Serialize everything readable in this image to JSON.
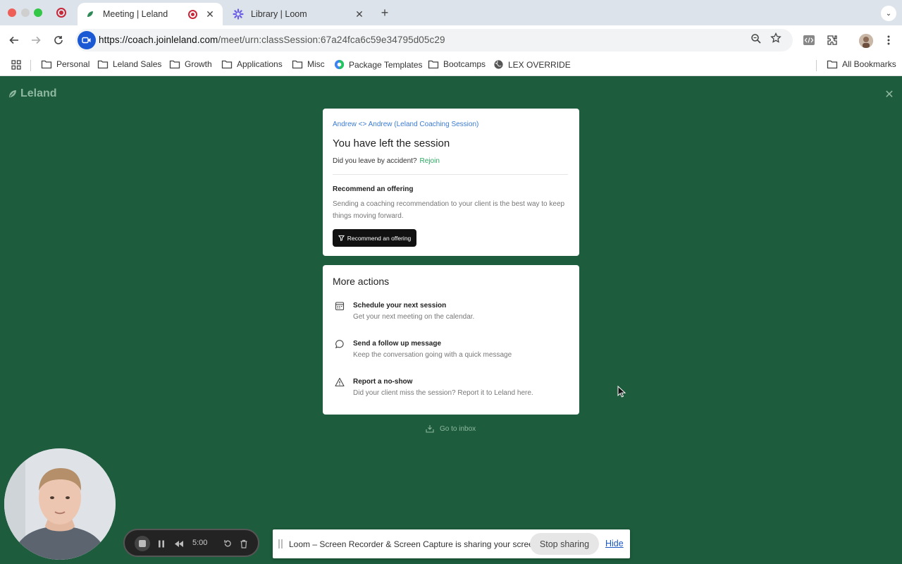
{
  "browser": {
    "tabs": [
      {
        "title": "Meeting | Leland",
        "active": true
      },
      {
        "title": "Library | Loom",
        "active": false
      }
    ],
    "url": {
      "host": "https://coach.joinleland.com",
      "path": "/meet/urn:classSession:67a24fca6c59e34795d05c29"
    },
    "bookmarks": [
      {
        "label": "Personal",
        "icon": "folder-icon"
      },
      {
        "label": "Leland Sales",
        "icon": "folder-icon"
      },
      {
        "label": "Growth",
        "icon": "folder-icon"
      },
      {
        "label": "Applications",
        "icon": "folder-icon"
      },
      {
        "label": "Misc",
        "icon": "folder-icon"
      },
      {
        "label": "Package Templates",
        "icon": "globe-color-icon"
      },
      {
        "label": "Bootcamps",
        "icon": "folder-icon"
      },
      {
        "label": "LEX OVERRIDE",
        "icon": "globe-icon"
      },
      {
        "label": "All Bookmarks",
        "icon": "folder-icon"
      }
    ]
  },
  "page": {
    "brand": "Leland",
    "session_card": {
      "session_name": "Andrew <> Andrew (Leland Coaching Session)",
      "title": "You have left the session",
      "accident_prompt": "Did you leave by accident?",
      "rejoin_label": "Rejoin",
      "recommend_title": "Recommend an offering",
      "recommend_desc": "Sending a coaching recommendation to your client is the best way to keep things moving forward.",
      "recommend_button": "Recommend an offering"
    },
    "more_actions": {
      "title": "More actions",
      "items": [
        {
          "title": "Schedule your next session",
          "desc": "Get your next meeting on the calendar.",
          "icon": "calendar-icon"
        },
        {
          "title": "Send a follow up message",
          "desc": "Keep the conversation going with a quick message",
          "icon": "chat-bubble-icon"
        },
        {
          "title": "Report a no-show",
          "desc": "Did your client miss the session? Report it to Leland here.",
          "icon": "warning-icon"
        }
      ]
    },
    "inbox_label": "Go to inbox"
  },
  "loom": {
    "timer": "5:00",
    "share_text": "Loom – Screen Recorder & Screen Capture is sharing your screen.",
    "stop_sharing": "Stop sharing",
    "hide": "Hide"
  },
  "colors": {
    "page_bg": "#1d5c3c",
    "link_blue": "#3a7bd5",
    "rejoin_green": "#2da862",
    "record_red": "#c6283a"
  }
}
